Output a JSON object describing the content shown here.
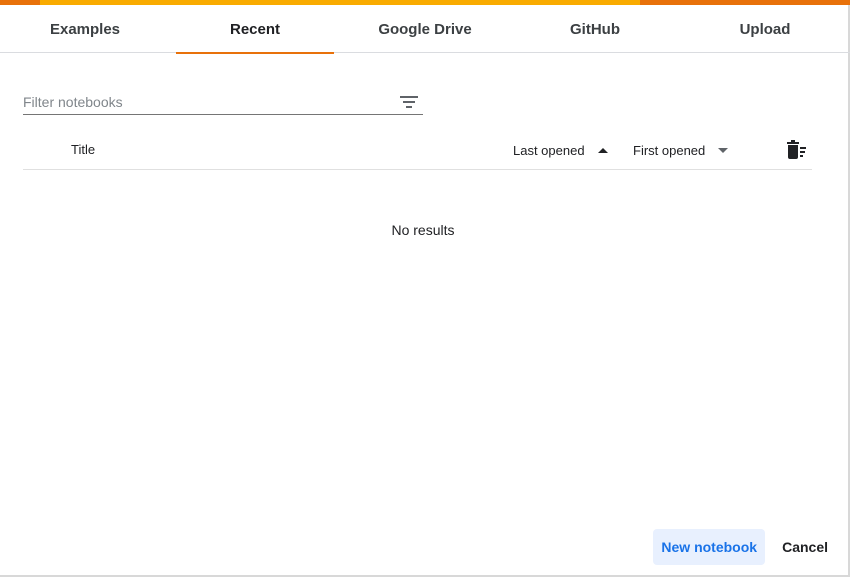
{
  "tabs": [
    {
      "label": "Examples",
      "active": false
    },
    {
      "label": "Recent",
      "active": true
    },
    {
      "label": "Google Drive",
      "active": false
    },
    {
      "label": "GitHub",
      "active": false
    },
    {
      "label": "Upload",
      "active": false
    }
  ],
  "filter": {
    "placeholder": "Filter notebooks",
    "value": "",
    "icon": "filter-list-icon"
  },
  "table": {
    "columns": {
      "title": "Title",
      "last_opened": "Last opened",
      "first_opened": "First opened"
    },
    "last_opened_sort": "ascending",
    "first_opened_sort": "descending",
    "delete_icon": "delete-sweep-icon",
    "empty_message": "No results"
  },
  "footer": {
    "new_notebook": "New notebook",
    "cancel": "Cancel"
  },
  "colors": {
    "accent_orange": "#e8710a",
    "accent_yellow": "#f9ab00",
    "primary_blue": "#1a73e8",
    "primary_button_bg": "#e8f0fe"
  }
}
